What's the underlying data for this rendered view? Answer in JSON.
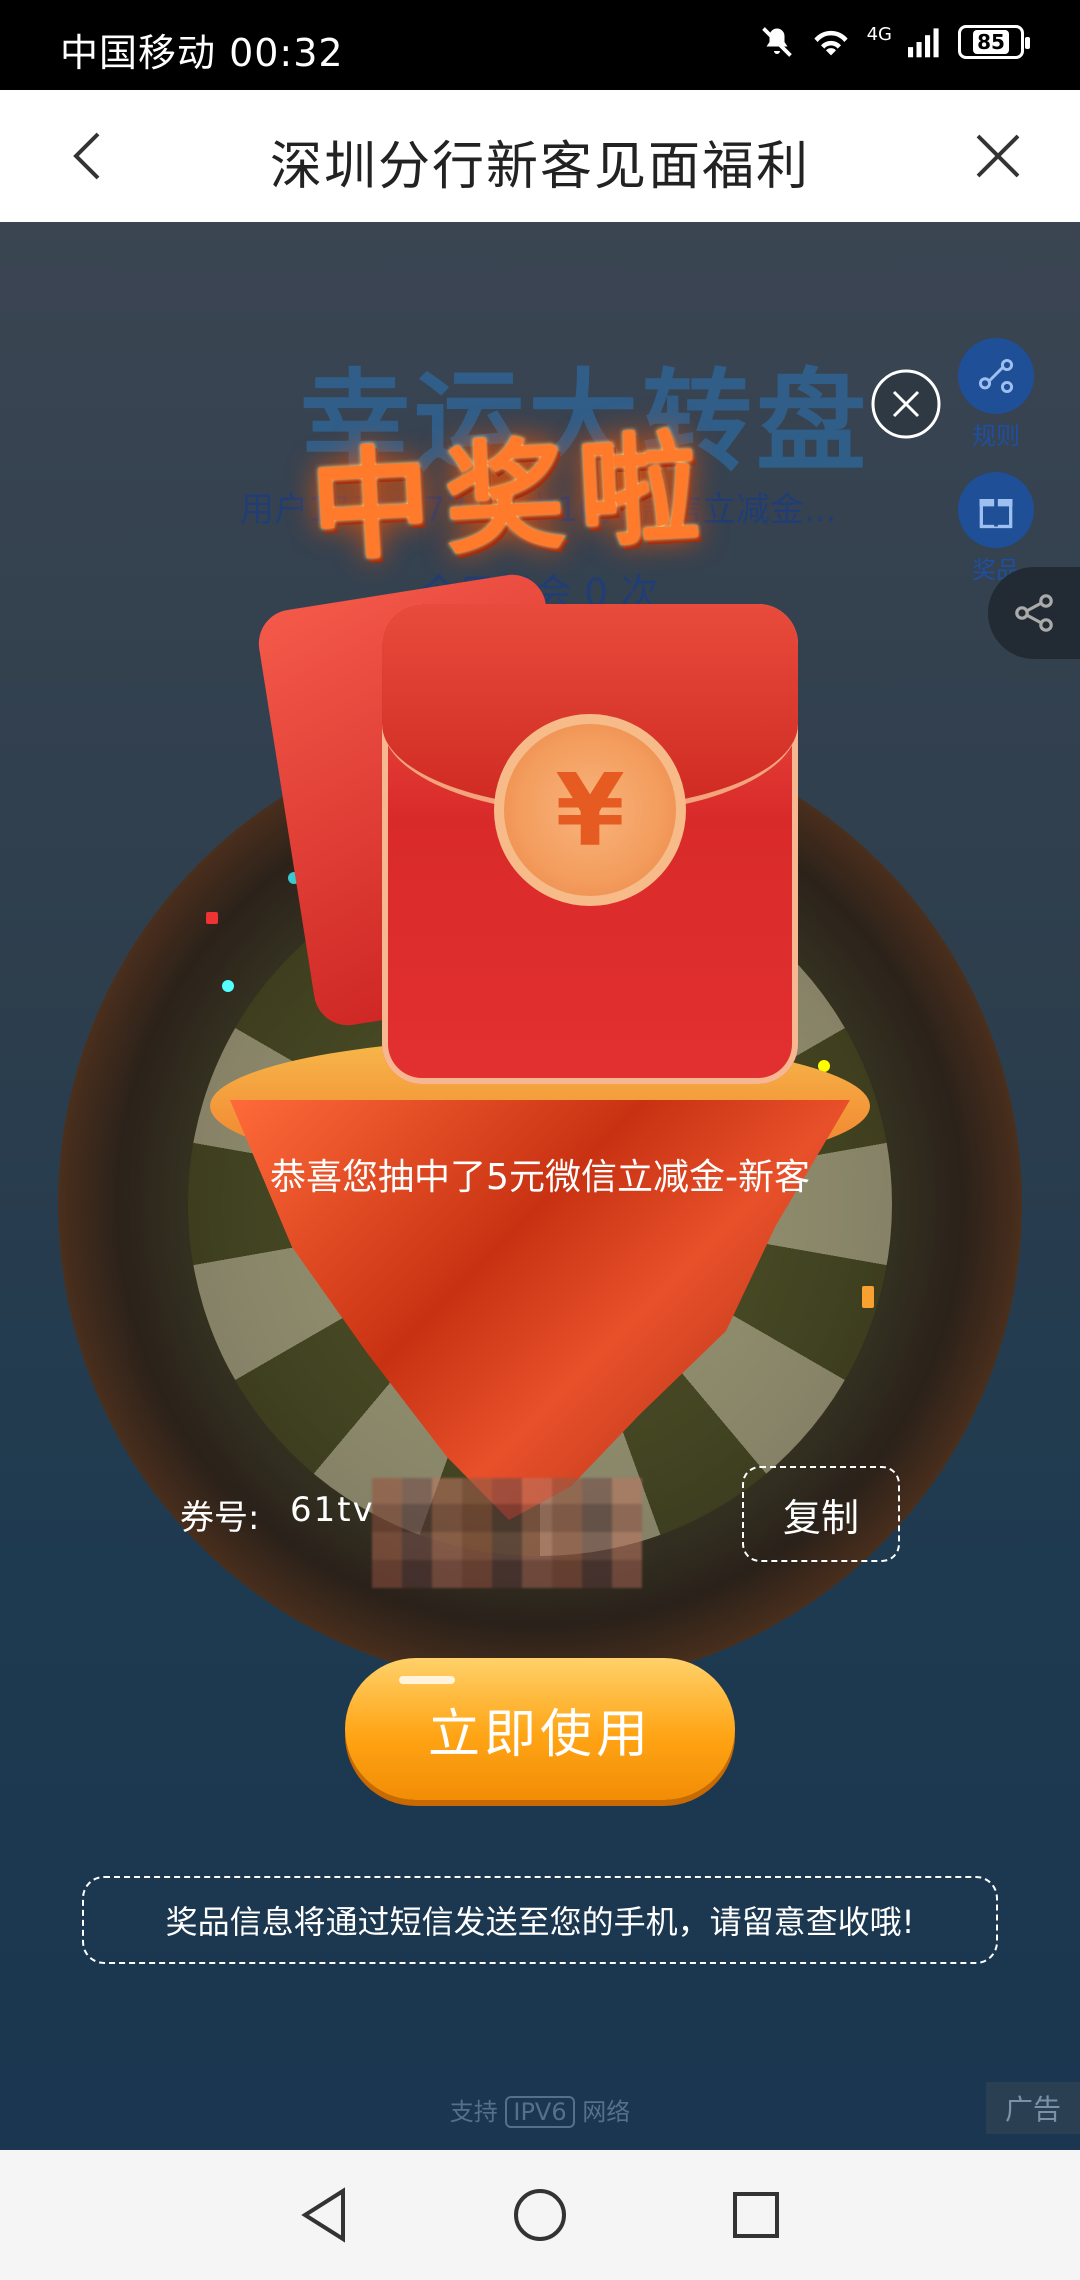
{
  "status_bar": {
    "carrier_time": "中国移动 00:32",
    "network": "4G",
    "battery": "85"
  },
  "header": {
    "title": "深圳分行新客见面福利",
    "back_icon": "chevron-left-icon",
    "close_icon": "close-icon"
  },
  "background": {
    "game_title": "幸运大转盘",
    "user_winner": "用户177***774抽中10元微信立减金...",
    "today_chances": "今日机会 0 次",
    "rules_label": "规则",
    "prizes_label": "奖品",
    "ipv6_prefix": "支持",
    "ipv6_badge": "IPV6",
    "ipv6_suffix": "网络",
    "ad_label": "广告"
  },
  "popup": {
    "win_title": "中奖啦",
    "congrats_text": "恭喜您抽中了5元微信立减金-新客",
    "coupon_label": "券号:",
    "coupon_value": "61tv",
    "copy_button": "复制",
    "use_button": "立即使用",
    "notice_text": "奖品信息将通过短信发送至您的手机，请留意查收哦!",
    "coin_symbol": "¥"
  },
  "colors": {
    "accent_orange": "#ffa414",
    "envelope_red": "#d92a2a",
    "overlay_bg": "#1e3a50"
  }
}
